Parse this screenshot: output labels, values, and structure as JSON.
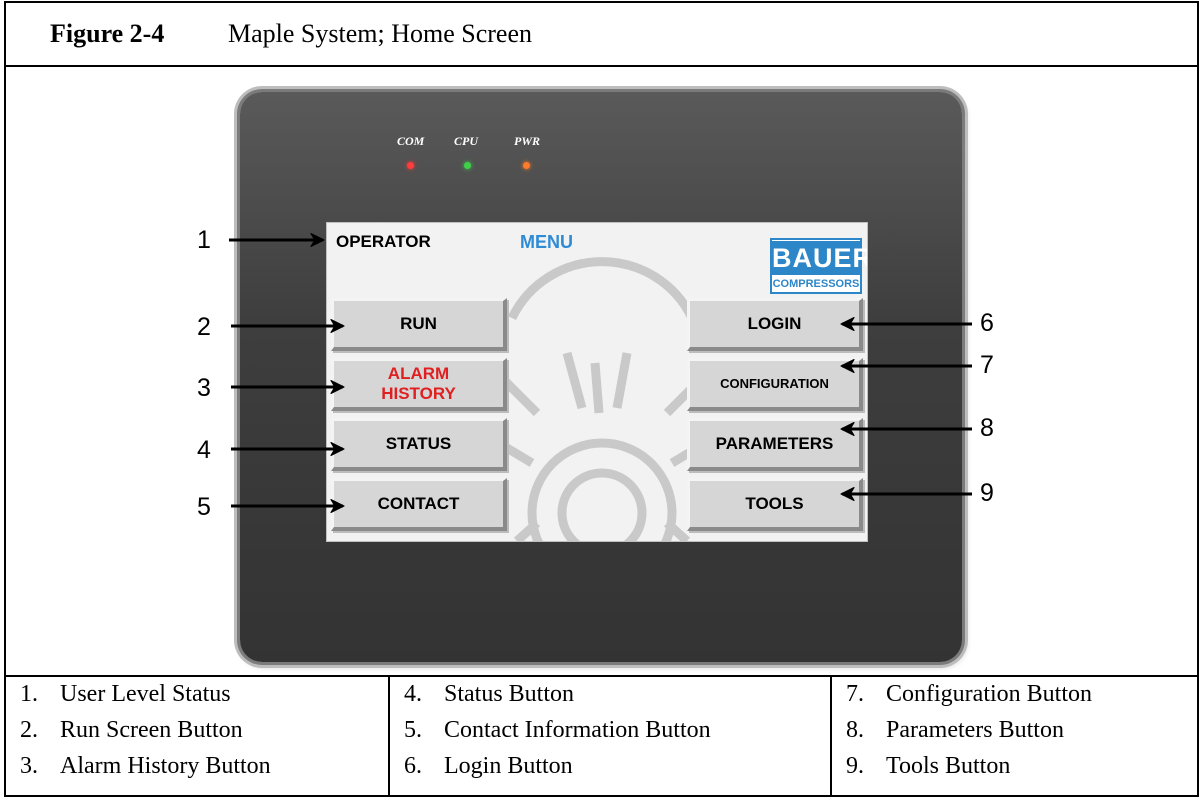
{
  "figure": {
    "number": "Figure 2-4",
    "title": "Maple System; Home Screen"
  },
  "device": {
    "leds": [
      {
        "label": "COM",
        "color": "#ff3b3b"
      },
      {
        "label": "CPU",
        "color": "#3fd14a"
      },
      {
        "label": "PWR",
        "color": "#ff7a2a"
      }
    ]
  },
  "screen": {
    "user_level": "OPERATOR",
    "menu_title": "MENU",
    "logo": {
      "main": "BAUER",
      "sub": "COMPRESSORS"
    },
    "buttons_left": {
      "run": "RUN",
      "alarm_history_line1": "ALARM",
      "alarm_history_line2": "HISTORY",
      "status": "STATUS",
      "contact": "CONTACT"
    },
    "buttons_right": {
      "login": "LOGIN",
      "configuration": "CONFIGURATION",
      "parameters": "PARAMETERS",
      "tools": "TOOLS"
    }
  },
  "callouts": [
    "1",
    "2",
    "3",
    "4",
    "5",
    "6",
    "7",
    "8",
    "9"
  ],
  "legend": [
    {
      "num": "1.",
      "text": "User Level Status"
    },
    {
      "num": "2.",
      "text": "Run Screen Button"
    },
    {
      "num": "3.",
      "text": "Alarm History Button"
    },
    {
      "num": "4.",
      "text": "Status Button"
    },
    {
      "num": "5.",
      "text": "Contact Information Button"
    },
    {
      "num": "6.",
      "text": "Login Button"
    },
    {
      "num": "7.",
      "text": "Configuration Button"
    },
    {
      "num": "8.",
      "text": "Parameters Button"
    },
    {
      "num": "9.",
      "text": "Tools Button"
    }
  ]
}
